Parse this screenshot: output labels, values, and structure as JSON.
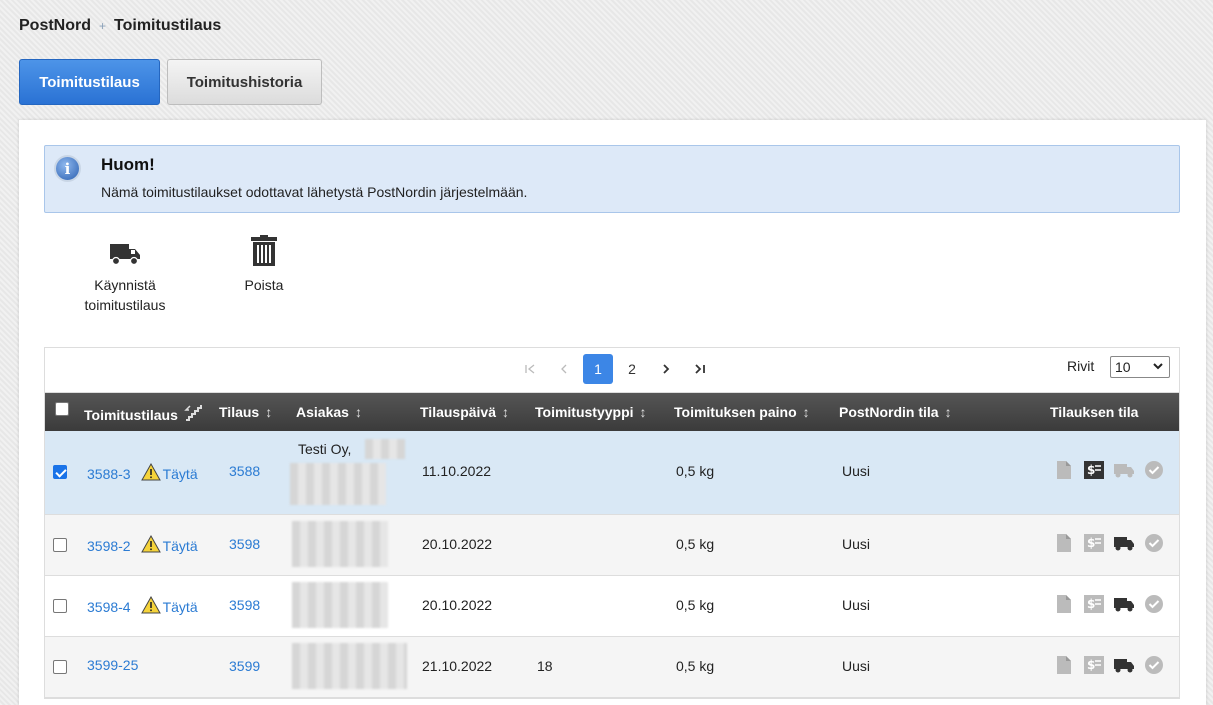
{
  "breadcrumb": {
    "root": "PostNord",
    "sep": "+",
    "current": "Toimitustilaus"
  },
  "tabs": [
    {
      "label": "Toimitustilaus",
      "active": true
    },
    {
      "label": "Toimitushistoria",
      "active": false
    }
  ],
  "notice": {
    "title": "Huom!",
    "text": "Nämä toimitustilaukset odottavat lähetystä PostNordin järjestelmään.",
    "icon": "info-icon"
  },
  "actions": {
    "start": {
      "line1": "Käynnistä",
      "line2": "toimitustilaus",
      "icon": "truck-icon"
    },
    "delete": {
      "label": "Poista",
      "icon": "trash-icon"
    }
  },
  "pager": {
    "pages": [
      "1",
      "2"
    ],
    "current": "1",
    "rows_label": "Rivit",
    "rows_value": "10"
  },
  "columns": {
    "order": "Toimitustilaus",
    "tilaus": "Tilaus",
    "asiakas": "Asiakas",
    "date": "Tilauspäivä",
    "type": "Toimitustyyppi",
    "weight": "Toimituksen paino",
    "pn_status": "PostNordin tila",
    "status": "Tilauksen tila"
  },
  "rows": [
    {
      "id": "3588-3",
      "warn": "Täytä",
      "tilaus": "3588",
      "customer": "Testi Oy,",
      "date": "11.10.2022",
      "type": "",
      "weight": "0,5 kg",
      "pn_status": "Uusi",
      "checked": true
    },
    {
      "id": "3598-2",
      "warn": "Täytä",
      "tilaus": "3598",
      "customer": "",
      "date": "20.10.2022",
      "type": "",
      "weight": "0,5 kg",
      "pn_status": "Uusi",
      "checked": false
    },
    {
      "id": "3598-4",
      "warn": "Täytä",
      "tilaus": "3598",
      "customer": "",
      "date": "20.10.2022",
      "type": "",
      "weight": "0,5 kg",
      "pn_status": "Uusi",
      "checked": false
    },
    {
      "id": "3599-25",
      "warn": "",
      "tilaus": "3599",
      "customer": "",
      "date": "21.10.2022",
      "type": "18",
      "weight": "0,5 kg",
      "pn_status": "Uusi",
      "checked": false
    }
  ],
  "colors": {
    "accent": "#2b7bd3",
    "header": "#444444",
    "selected": "#d9e8f5"
  }
}
